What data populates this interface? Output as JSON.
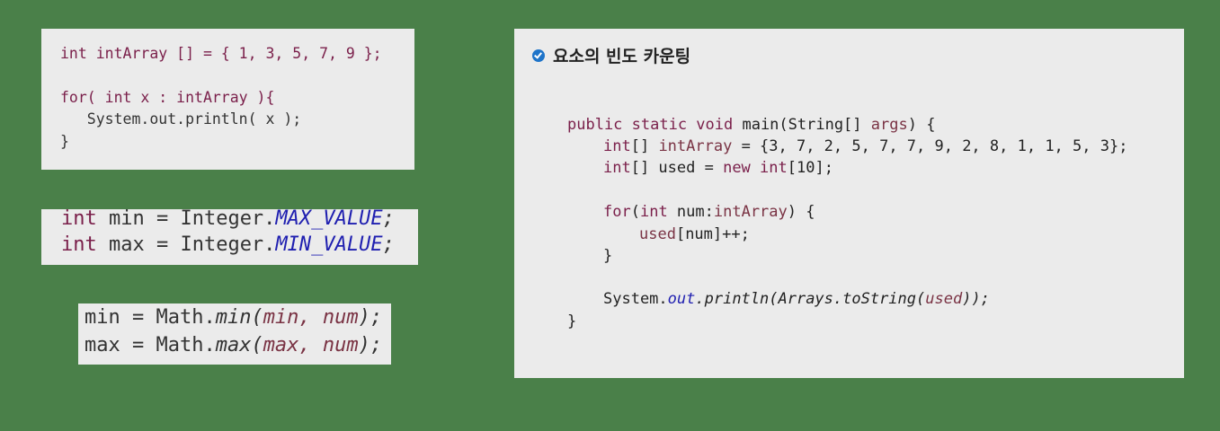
{
  "snippet1": {
    "line1": "int intArray [] = { 1, 3, 5, 7, 9 };",
    "line2": "for( int x : intArray ){",
    "line3": "   System.out.println( x );",
    "line4": "}"
  },
  "snippet2": {
    "line1": {
      "kw": "int",
      "a": " min = Integer.",
      "field": "MAX_VALUE",
      "end": ";"
    },
    "line2": {
      "kw": "int",
      "a": " max = Integer.",
      "field": "MIN_VALUE",
      "end": ";"
    }
  },
  "snippet3": {
    "line1": {
      "a": "min = Math.",
      "method": "min(",
      "args": "min, num",
      "end": ");"
    },
    "line2": {
      "a": "max = Math.",
      "method": "max(",
      "args": "max, num",
      "end": ");"
    }
  },
  "main_panel": {
    "title": "요소의 빈도 카운팅",
    "line1": {
      "kw": "public static void",
      "a": " main(String[] ",
      "arg": "args",
      "end": ") {"
    },
    "line2": {
      "kw": "int",
      "a": "[] ",
      "var": "intArray",
      "end": " = {3, 7, 2, 5, 7, 7, 9, 2, 8, 1, 1, 5, 3};"
    },
    "line3": {
      "kw": "int",
      "a": "[] used = ",
      "kw2": "new",
      "b": " ",
      "kw3": "int",
      "end": "[10];"
    },
    "line4": {
      "kw": "for",
      "a": "(",
      "kw2": "int",
      "b": " num:",
      "var": "intArray",
      "end": ") {"
    },
    "line5": {
      "var": "used",
      "end": "[num]++;"
    },
    "line6": "}",
    "line7": {
      "a": "System.",
      "field": "out",
      "m": ".println(Arrays.toString(",
      "var": "used",
      "end": "));"
    },
    "line8": "}"
  }
}
